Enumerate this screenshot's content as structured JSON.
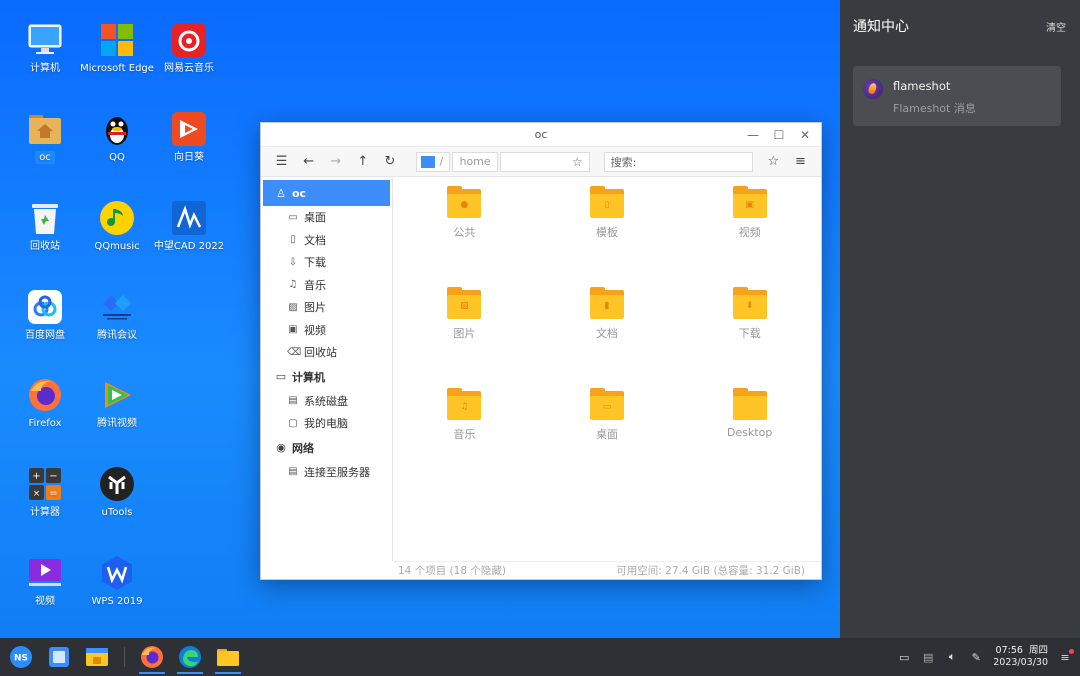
{
  "desktop": {
    "icons": [
      {
        "label": "计算机"
      },
      {
        "label": "Microsoft Edge"
      },
      {
        "label": "网易云音乐"
      },
      {
        "label": "oc"
      },
      {
        "label": "QQ"
      },
      {
        "label": "向日葵"
      },
      {
        "label": "回收站"
      },
      {
        "label": "QQmusic"
      },
      {
        "label": "中望CAD 2022"
      },
      {
        "label": "百度网盘"
      },
      {
        "label": "腾讯会议"
      },
      {
        "label": "Firefox"
      },
      {
        "label": "腾讯视频"
      },
      {
        "label": "计算器"
      },
      {
        "label": "uTools"
      },
      {
        "label": "视频"
      },
      {
        "label": "WPS 2019"
      }
    ]
  },
  "file_manager": {
    "title": "oc",
    "breadcrumb": [
      "/",
      "home",
      ""
    ],
    "search_placeholder": "搜索:",
    "sidebar": {
      "user": "oc",
      "places": [
        "桌面",
        "文档",
        "下载",
        "音乐",
        "图片",
        "视频",
        "回收站"
      ],
      "computer_head": "计算机",
      "computer_items": [
        "系统磁盘",
        "我的电脑"
      ],
      "network_head": "网络",
      "network_items": [
        "连接至服务器"
      ]
    },
    "folders": [
      {
        "name": "公共",
        "icon": "person-icon"
      },
      {
        "name": "模板",
        "icon": "template-icon"
      },
      {
        "name": "视频",
        "icon": "video-icon"
      },
      {
        "name": "图片",
        "icon": "image-icon"
      },
      {
        "name": "文档",
        "icon": "document-icon"
      },
      {
        "name": "下载",
        "icon": "download-icon"
      },
      {
        "name": "音乐",
        "icon": "music-icon"
      },
      {
        "name": "桌面",
        "icon": "desktop-icon"
      },
      {
        "name": "Desktop",
        "icon": ""
      }
    ],
    "status_left": "14 个项目 (18 个隐藏)",
    "status_right": "可用空间: 27.4 GiB (总容量: 31.2 GiB)"
  },
  "notification_center": {
    "title": "通知中心",
    "clear": "清空",
    "card": {
      "app": "flameshot",
      "message": "Flameshot 消息"
    }
  },
  "taskbar": {
    "start": "NS",
    "time": "07:56",
    "weekday": "周四",
    "date": "2023/03/30"
  },
  "colors": {
    "accent": "#3d8dfa",
    "folder": "#ffc426",
    "panel": "#383b3f",
    "taskbar": "#2d3034"
  }
}
